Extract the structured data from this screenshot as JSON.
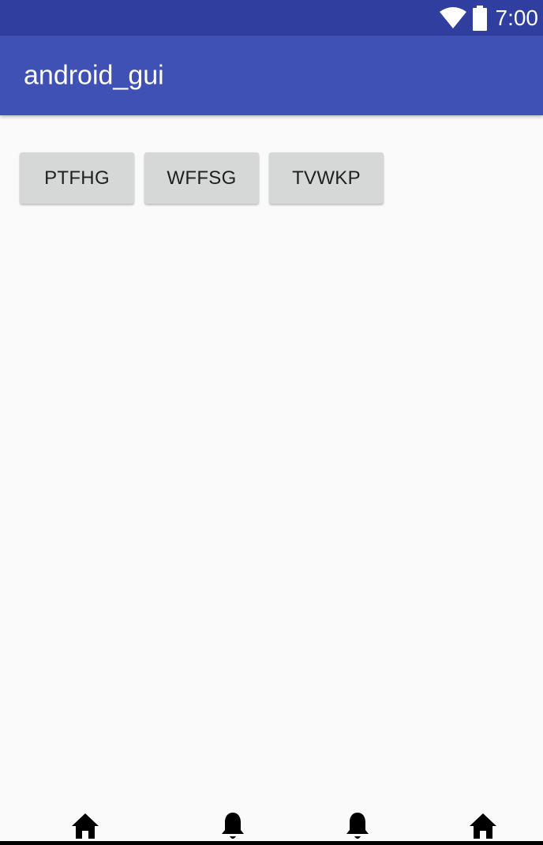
{
  "status_bar": {
    "time": "7:00",
    "icons": [
      "wifi-icon",
      "battery-icon"
    ],
    "background": "#303f9f"
  },
  "app_bar": {
    "title": "android_gui",
    "background": "#3f51b5"
  },
  "buttons": [
    {
      "label": "PTFHG"
    },
    {
      "label": "WFFSG"
    },
    {
      "label": "TVWKP"
    }
  ],
  "bottom_nav": {
    "icons": [
      "home-icon",
      "bell-icon",
      "bell-icon",
      "home-icon"
    ]
  }
}
